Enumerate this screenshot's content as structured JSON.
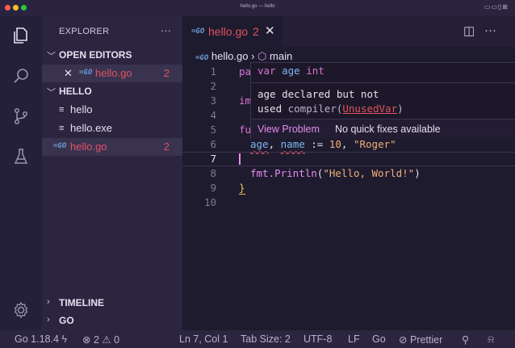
{
  "window": {
    "title": "hello.go — hello"
  },
  "sidebar": {
    "header": "EXPLORER",
    "more": "···",
    "open_editors": {
      "label": "OPEN EDITORS",
      "items": [
        {
          "name": "hello.go",
          "count": "2",
          "close": "✕",
          "icon": "go-file-icon"
        }
      ]
    },
    "workspace": {
      "label": "HELLO",
      "files": [
        {
          "name": "hello",
          "icon": "file-lines-icon"
        },
        {
          "name": "hello.exe",
          "icon": "file-lines-icon"
        },
        {
          "name": "hello.go",
          "count": "2",
          "icon": "go-file-icon"
        }
      ]
    },
    "timeline": "TIMELINE",
    "go": "GO"
  },
  "editor": {
    "tab": {
      "label": "hello.go",
      "count": "2",
      "close": "✕"
    },
    "breadcrumb": {
      "file": "hello.go",
      "separator": "›",
      "symbol": "main"
    },
    "line_numbers": [
      "1",
      "2",
      "3",
      "4",
      "5",
      "6",
      "7",
      "8",
      "9",
      "10"
    ],
    "current_line": "7",
    "code": {
      "line1_kw": "pa",
      "line3_kw": "imp",
      "line5_kw": "fu",
      "line6_var": "age",
      "line6_rest1": ", ",
      "line6_var2": "name",
      "line6_op": " := ",
      "line6_num": "10",
      "line6_comma": ", ",
      "line6_str": "\"Roger\"",
      "line8_pkg": "fmt.",
      "line8_fn": "Println",
      "line8_open": "(",
      "line8_str": "\"Hello, World!\"",
      "line8_close": ")",
      "line9": "}"
    },
    "hover": {
      "signature_kw": "var",
      "signature_name": "age",
      "signature_type": "int",
      "message_line1": "age declared but not",
      "message_line2_a": "used",
      "message_line2_b": " compiler(",
      "message_line2_link": "UnusedVar",
      "message_line2_c": ")",
      "view_problem": "View Problem",
      "no_fixes": "No quick fixes available"
    }
  },
  "statusbar": {
    "go_version": "Go 1.18.4",
    "errors": "2",
    "warnings": "0",
    "position": "Ln 7, Col 1",
    "tab_size": "Tab Size: 2",
    "encoding": "UTF-8",
    "eol": "LF",
    "language": "Go",
    "prettier": "Prettier"
  },
  "colors": {
    "error": "#e05260",
    "accent": "#e48cf0",
    "background": "#1f1b2e"
  }
}
